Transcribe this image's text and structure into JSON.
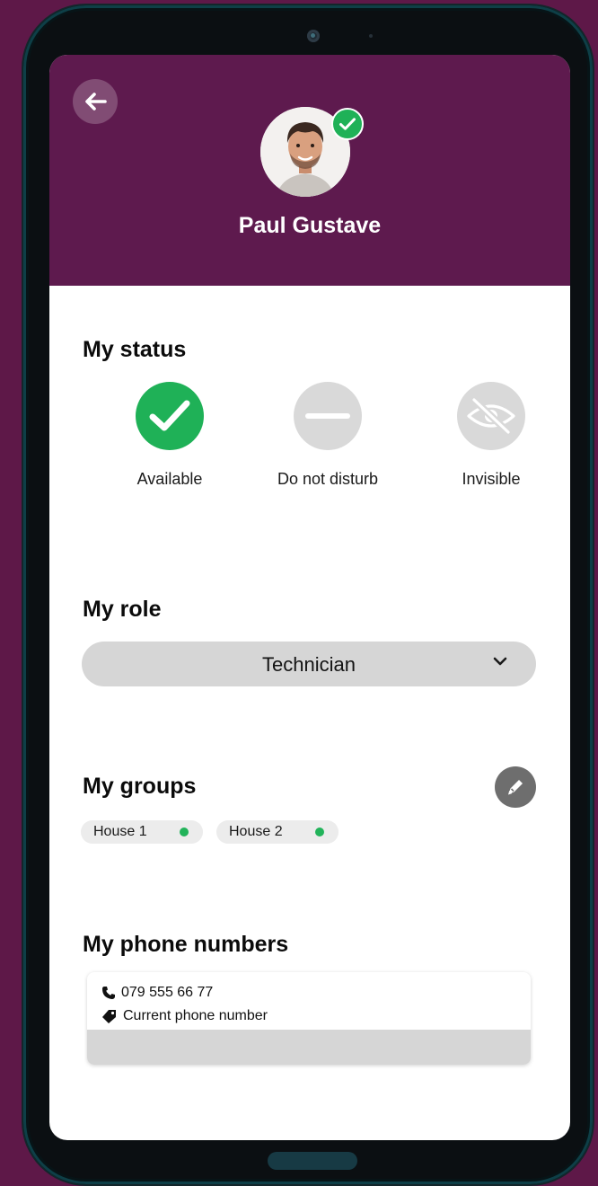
{
  "profile": {
    "name": "Paul Gustave",
    "status_badge_icon": "check-icon",
    "header_color": "#5e1a4e"
  },
  "status": {
    "title": "My status",
    "options": [
      {
        "label": "Available",
        "icon": "check-icon",
        "selected": true,
        "color": "#1fb157"
      },
      {
        "label": "Do not disturb",
        "icon": "minus-icon",
        "selected": false,
        "color": "#d9d9d9"
      },
      {
        "label": "Invisible",
        "icon": "eye-slash-icon",
        "selected": false,
        "color": "#d9d9d9"
      }
    ]
  },
  "role": {
    "title": "My role",
    "selected": "Technician"
  },
  "groups": {
    "title": "My groups",
    "items": [
      {
        "label": "House 1",
        "status_color": "#22b35a"
      },
      {
        "label": "House 2",
        "status_color": "#22b35a"
      }
    ]
  },
  "phones": {
    "title": "My phone numbers",
    "number": "079 555 66 77",
    "tag": "Current phone number"
  }
}
